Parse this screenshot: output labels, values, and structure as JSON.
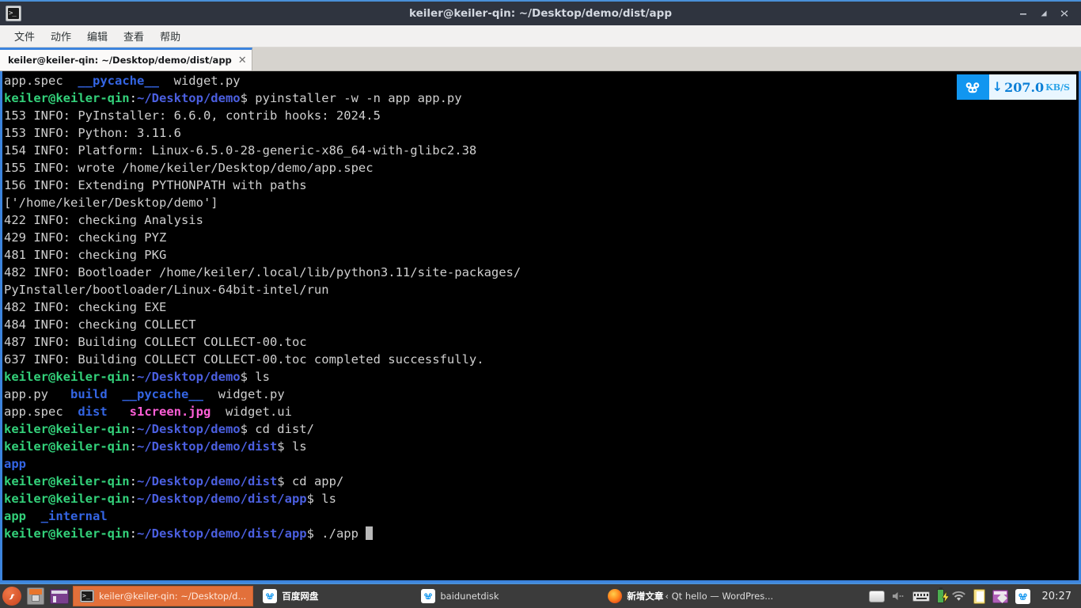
{
  "window": {
    "title": "keiler@keiler-qin: ~/Desktop/demo/dist/app",
    "app_icon": "terminal-icon",
    "buttons": {
      "minimize": "−",
      "maximize": "⤡",
      "close": "✕"
    }
  },
  "menubar": {
    "items": [
      "文件",
      "动作",
      "编辑",
      "查看",
      "帮助"
    ]
  },
  "tabbar": {
    "tab_label": "keiler@keiler-qin: ~/Desktop/demo/dist/app",
    "close_label": "✕"
  },
  "speed_widget": {
    "icon": "baidu-netdisk-icon",
    "arrow": "↓",
    "value": "207.0",
    "unit": "KB/S",
    "icon_bg": "#1196f0",
    "panel_bg": "#e9f6ff",
    "value_color": "#0b7fd6"
  },
  "terminal": {
    "prompt_user": "keiler@keiler-qin",
    "prompt_symbol": "$",
    "colors": {
      "background": "#000000",
      "text": "#cfcfcf",
      "user_host": "#33d17a",
      "path": "#4b5fe0",
      "directory": "#3465e4",
      "image_file": "#ff5fd7",
      "executable": "#33d17a",
      "cursor": "#b9b9b9",
      "border": "#3c84dd"
    },
    "lines": [
      {
        "id": "l0",
        "segs": [
          {
            "t": "app.spec  ",
            "c": "plain"
          },
          {
            "t": "__pycache__",
            "c": "blue"
          },
          {
            "t": "  widget.py",
            "c": "plain"
          }
        ]
      },
      {
        "id": "l1",
        "segs": [
          {
            "t": "keiler@keiler-qin",
            "c": "gbold"
          },
          {
            "t": ":",
            "c": "white"
          },
          {
            "t": "~/Desktop/demo",
            "c": "bblue"
          },
          {
            "t": "$ pyinstaller -w -n app app.py",
            "c": "plain"
          }
        ]
      },
      {
        "id": "l2",
        "segs": [
          {
            "t": "153 INFO: PyInstaller: 6.6.0, contrib hooks: 2024.5",
            "c": "plain"
          }
        ]
      },
      {
        "id": "l3",
        "segs": [
          {
            "t": "153 INFO: Python: 3.11.6",
            "c": "plain"
          }
        ]
      },
      {
        "id": "l4",
        "segs": [
          {
            "t": "154 INFO: Platform: Linux-6.5.0-28-generic-x86_64-with-glibc2.38",
            "c": "plain"
          }
        ]
      },
      {
        "id": "l5",
        "segs": [
          {
            "t": "155 INFO: wrote /home/keiler/Desktop/demo/app.spec",
            "c": "plain"
          }
        ]
      },
      {
        "id": "l6",
        "segs": [
          {
            "t": "156 INFO: Extending PYTHONPATH with paths",
            "c": "plain"
          }
        ]
      },
      {
        "id": "l7",
        "segs": [
          {
            "t": "['/home/keiler/Desktop/demo']",
            "c": "plain"
          }
        ]
      },
      {
        "id": "l8",
        "segs": [
          {
            "t": "422 INFO: checking Analysis",
            "c": "plain"
          }
        ]
      },
      {
        "id": "l9",
        "segs": [
          {
            "t": "429 INFO: checking PYZ",
            "c": "plain"
          }
        ]
      },
      {
        "id": "l10",
        "segs": [
          {
            "t": "481 INFO: checking PKG",
            "c": "plain"
          }
        ]
      },
      {
        "id": "l11",
        "segs": [
          {
            "t": "482 INFO: Bootloader /home/keiler/.local/lib/python3.11/site-packages/",
            "c": "plain"
          }
        ]
      },
      {
        "id": "l12",
        "segs": [
          {
            "t": "PyInstaller/bootloader/Linux-64bit-intel/run",
            "c": "plain"
          }
        ]
      },
      {
        "id": "l13",
        "segs": [
          {
            "t": "482 INFO: checking EXE",
            "c": "plain"
          }
        ]
      },
      {
        "id": "l14",
        "segs": [
          {
            "t": "484 INFO: checking COLLECT",
            "c": "plain"
          }
        ]
      },
      {
        "id": "l15",
        "segs": [
          {
            "t": "487 INFO: Building COLLECT COLLECT-00.toc",
            "c": "plain"
          }
        ]
      },
      {
        "id": "l16",
        "segs": [
          {
            "t": "637 INFO: Building COLLECT COLLECT-00.toc completed successfully.",
            "c": "plain"
          }
        ]
      },
      {
        "id": "l17",
        "segs": [
          {
            "t": "keiler@keiler-qin",
            "c": "gbold"
          },
          {
            "t": ":",
            "c": "white"
          },
          {
            "t": "~/Desktop/demo",
            "c": "bblue"
          },
          {
            "t": "$ ls",
            "c": "plain"
          }
        ]
      },
      {
        "id": "l18",
        "segs": [
          {
            "t": "app.py   ",
            "c": "plain"
          },
          {
            "t": "build",
            "c": "blue"
          },
          {
            "t": "  ",
            "c": "plain"
          },
          {
            "t": "__pycache__",
            "c": "blue"
          },
          {
            "t": "  widget.py",
            "c": "plain"
          }
        ]
      },
      {
        "id": "l19",
        "segs": [
          {
            "t": "app.spec  ",
            "c": "plain"
          },
          {
            "t": "dist",
            "c": "blue"
          },
          {
            "t": "   ",
            "c": "plain"
          },
          {
            "t": "s1creen.jpg",
            "c": "pink"
          },
          {
            "t": "  widget.ui",
            "c": "plain"
          }
        ]
      },
      {
        "id": "l20",
        "segs": [
          {
            "t": "keiler@keiler-qin",
            "c": "gbold"
          },
          {
            "t": ":",
            "c": "white"
          },
          {
            "t": "~/Desktop/demo",
            "c": "bblue"
          },
          {
            "t": "$ cd dist/",
            "c": "plain"
          }
        ]
      },
      {
        "id": "l21",
        "segs": [
          {
            "t": "keiler@keiler-qin",
            "c": "gbold"
          },
          {
            "t": ":",
            "c": "white"
          },
          {
            "t": "~/Desktop/demo/dist",
            "c": "bblue"
          },
          {
            "t": "$ ls",
            "c": "plain"
          }
        ]
      },
      {
        "id": "l22",
        "segs": [
          {
            "t": "app",
            "c": "blue"
          }
        ]
      },
      {
        "id": "l23",
        "segs": [
          {
            "t": "keiler@keiler-qin",
            "c": "gbold"
          },
          {
            "t": ":",
            "c": "white"
          },
          {
            "t": "~/Desktop/demo/dist",
            "c": "bblue"
          },
          {
            "t": "$ cd app/",
            "c": "plain"
          }
        ]
      },
      {
        "id": "l24",
        "segs": [
          {
            "t": "keiler@keiler-qin",
            "c": "gbold"
          },
          {
            "t": ":",
            "c": "white"
          },
          {
            "t": "~/Desktop/demo/dist/app",
            "c": "bblue"
          },
          {
            "t": "$ ls",
            "c": "plain"
          }
        ]
      },
      {
        "id": "l25",
        "segs": [
          {
            "t": "app",
            "c": "gbold"
          },
          {
            "t": "  ",
            "c": "plain"
          },
          {
            "t": "_internal",
            "c": "blue"
          }
        ]
      },
      {
        "id": "l26",
        "segs": [
          {
            "t": "keiler@keiler-qin",
            "c": "gbold"
          },
          {
            "t": ":",
            "c": "white"
          },
          {
            "t": "~/Desktop/demo/dist/app",
            "c": "bblue"
          },
          {
            "t": "$ ./app ",
            "c": "plain"
          },
          {
            "t": "",
            "c": "cursor"
          }
        ]
      }
    ]
  },
  "taskbar": {
    "launchers": [
      {
        "name": "start-menu",
        "icon": "ubuntu-orb-icon",
        "glyph": ""
      },
      {
        "name": "file-manager",
        "icon": "file-cabinet-icon"
      },
      {
        "name": "workspace-switcher",
        "icon": "windows-icon"
      }
    ],
    "tasks": [
      {
        "name": "task-terminal",
        "icon": "terminal-icon",
        "label": "keiler@keiler-qin: ~/Desktop/d...",
        "active": true
      },
      {
        "name": "task-baidu-netdisk-cn",
        "icon": "baidu-netdisk-icon",
        "label": "百度网盘",
        "active": false
      },
      {
        "name": "task-baidunetdisk",
        "icon": "baidu-netdisk-icon",
        "label": "baidunetdisk",
        "active": false
      },
      {
        "name": "task-firefox",
        "icon": "firefox-icon",
        "label_bold": "新增文章",
        "label": "‹ Qt hello — WordPres...",
        "active": false
      }
    ],
    "tray": [
      {
        "name": "disk-icon"
      },
      {
        "name": "volume-muted-icon",
        "glyph": "🔇"
      },
      {
        "name": "keyboard-icon"
      },
      {
        "name": "battery-charging-icon"
      },
      {
        "name": "wifi-icon"
      },
      {
        "name": "clipboard-icon"
      },
      {
        "name": "screenshot-icon"
      },
      {
        "name": "baidu-netdisk-tray-icon"
      }
    ],
    "clock": "20:27"
  }
}
